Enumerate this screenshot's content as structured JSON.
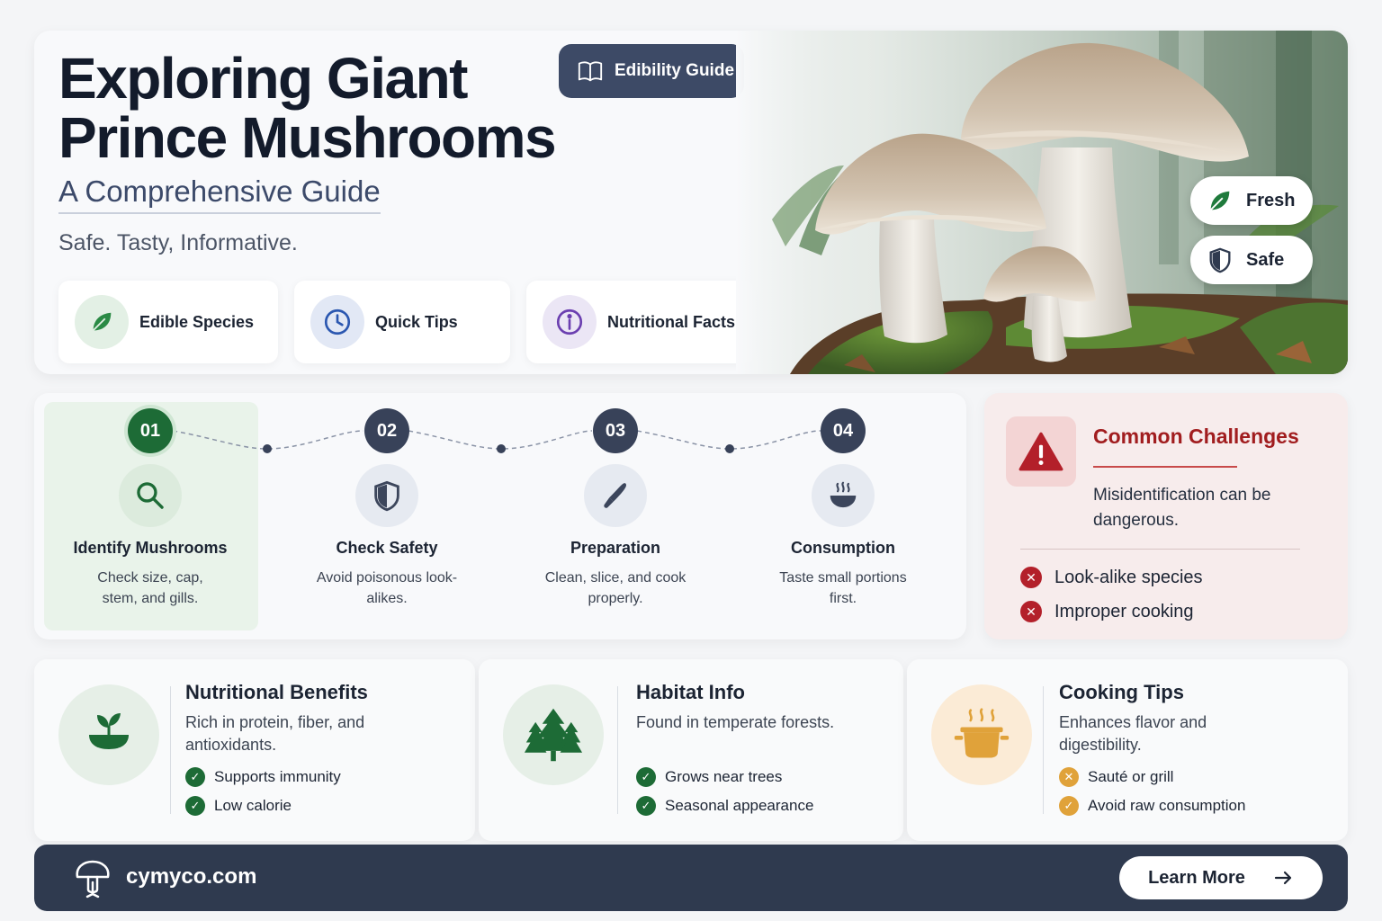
{
  "hero": {
    "title_line1": "Exploring Giant",
    "title_line2": "Prince Mushrooms",
    "subtitle": "A Comprehensive Guide",
    "tagline": "Safe. Tasty, Informative.",
    "badge_label": "Edibility Guide",
    "badge_icon": "book-icon",
    "features": [
      {
        "label": "Edible Species",
        "icon": "leaf-icon"
      },
      {
        "label": "Quick Tips",
        "icon": "clock-icon"
      },
      {
        "label": "Nutritional Facts",
        "icon": "info-icon"
      }
    ],
    "pills": [
      {
        "label": "Fresh",
        "icon": "leaf-icon"
      },
      {
        "label": "Safe",
        "icon": "shield-icon"
      }
    ]
  },
  "steps": [
    {
      "num": "01",
      "title": "Identify Mushrooms",
      "desc": "Check size, cap, stem, and gills.",
      "icon": "search-icon"
    },
    {
      "num": "02",
      "title": "Check Safety",
      "desc": "Avoid poisonous look-alikes.",
      "icon": "shield-icon"
    },
    {
      "num": "03",
      "title": "Preparation",
      "desc": "Clean, slice, and cook properly.",
      "icon": "knife-icon"
    },
    {
      "num": "04",
      "title": "Consumption",
      "desc": "Taste small portions first.",
      "icon": "bowl-icon"
    }
  ],
  "challenges": {
    "title": "Common Challenges",
    "desc": "Misidentification can be dangerous.",
    "items": [
      "Look-alike species",
      "Improper cooking"
    ],
    "icon": "warning-icon"
  },
  "cards": [
    {
      "title": "Nutritional Benefits",
      "desc": "Rich in protein, fiber, and antioxidants.",
      "items": [
        "Supports immunity",
        "Low calorie"
      ],
      "icon": "sprout-bowl-icon",
      "accent": "#1d6b36"
    },
    {
      "title": "Habitat Info",
      "desc": "Found in temperate forests.",
      "items": [
        "Grows near trees",
        "Seasonal appearance"
      ],
      "icon": "trees-icon",
      "accent": "#1d6b36"
    },
    {
      "title": "Cooking Tips",
      "desc": "Enhances flavor and digestibility.",
      "items": [
        "Sauté or grill",
        "Avoid raw consumption"
      ],
      "icon": "pot-icon",
      "accent": "#e0a23a"
    }
  ],
  "footer": {
    "site": "cymyco.com",
    "button": "Learn More",
    "logo_icon": "mushroom-logo-icon",
    "arrow_icon": "arrow-right-icon"
  },
  "colors": {
    "navy": "#2f3a4f",
    "green": "#1d6b36",
    "red": "#a11d1f",
    "orange": "#e0a23a"
  }
}
